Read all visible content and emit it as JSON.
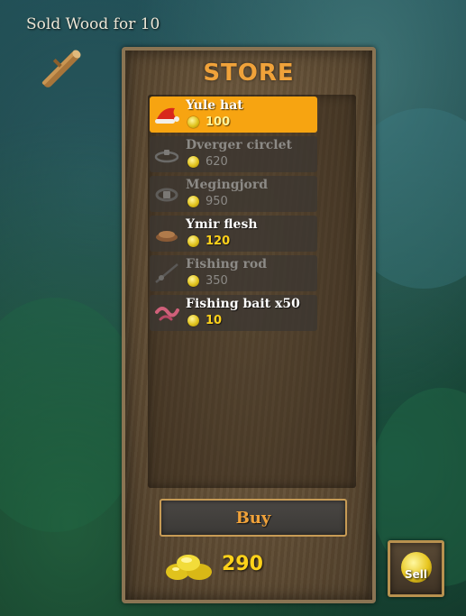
{
  "notification": {
    "text": "Sold Wood for 10",
    "icon": "wood-log-icon"
  },
  "store": {
    "title": "STORE",
    "items": [
      {
        "name": "Yule hat",
        "price": "100",
        "icon": "yule-hat-icon",
        "selected": true,
        "available": true
      },
      {
        "name": "Dverger circlet",
        "price": "620",
        "icon": "dverger-circlet-icon",
        "selected": false,
        "available": false
      },
      {
        "name": "Megingjord",
        "price": "950",
        "icon": "megingjord-belt-icon",
        "selected": false,
        "available": false
      },
      {
        "name": "Ymir flesh",
        "price": "120",
        "icon": "ymir-flesh-icon",
        "selected": false,
        "available": true
      },
      {
        "name": "Fishing rod",
        "price": "350",
        "icon": "fishing-rod-icon",
        "selected": false,
        "available": false
      },
      {
        "name": "Fishing bait x50",
        "price": "10",
        "icon": "fishing-bait-icon",
        "selected": false,
        "available": true
      }
    ],
    "buy_label": "Buy",
    "coins": "290",
    "sell_label": "Sell"
  },
  "colors": {
    "accent": "#f0a23a",
    "selected_row": "#f7a411",
    "coin_text": "#ffd21a",
    "unavailable_text": "#8c8a86"
  }
}
